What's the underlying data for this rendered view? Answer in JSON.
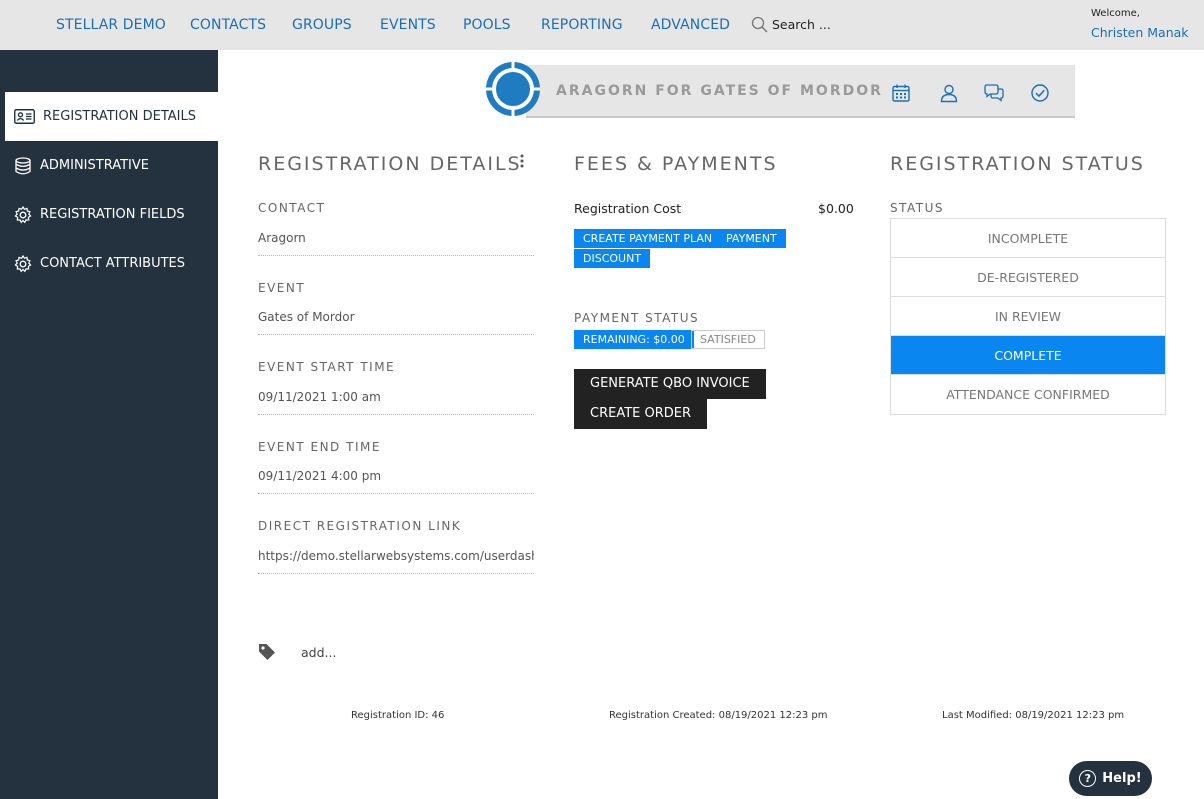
{
  "topnav": {
    "items": [
      "STELLAR DEMO",
      "CONTACTS",
      "GROUPS",
      "EVENTS",
      "POOLS",
      "REPORTING",
      "ADVANCED"
    ],
    "search_placeholder": "Search ...",
    "welcome": "Welcome,",
    "username": "Christen Manak"
  },
  "sidebar": {
    "items": [
      {
        "label": "REGISTRATION DETAILS",
        "icon": "contact-card-icon"
      },
      {
        "label": "ADMINISTRATIVE",
        "icon": "database-icon"
      },
      {
        "label": "REGISTRATION FIELDS",
        "icon": "gear-icon"
      },
      {
        "label": "CONTACT ATTRIBUTES",
        "icon": "gear-icon"
      }
    ]
  },
  "banner": {
    "title": "ARAGORN FOR GATES OF MORDOR",
    "icons": [
      "calendar-icon",
      "user-icon",
      "chat-icon",
      "check-circle-icon"
    ]
  },
  "details": {
    "title": "REGISTRATION DETAILS",
    "fields": [
      {
        "label": "CONTACT",
        "value": "Aragorn"
      },
      {
        "label": "EVENT",
        "value": "Gates of Mordor"
      },
      {
        "label": "EVENT START TIME",
        "value": "09/11/2021 1:00 am"
      },
      {
        "label": "EVENT END TIME",
        "value": "09/11/2021 4:00 pm"
      },
      {
        "label": "DIRECT REGISTRATION LINK",
        "value": "https://demo.stellarwebsystems.com/userdashboard"
      }
    ]
  },
  "fees": {
    "title": "FEES & PAYMENTS",
    "cost_label": "Registration Cost",
    "cost_value": "$0.00",
    "buttons": [
      "CREATE PAYMENT PLAN",
      "PAYMENT",
      "DISCOUNT"
    ],
    "payment_status_label": "PAYMENT STATUS",
    "remaining_badge": "REMAINING: $0.00",
    "satisfied_badge": "SATISFIED",
    "qbo_button": "GENERATE QBO INVOICE",
    "order_button": "CREATE ORDER"
  },
  "status": {
    "title": "REGISTRATION STATUS",
    "label": "STATUS",
    "options": [
      "INCOMPLETE",
      "DE-REGISTERED",
      "IN REVIEW",
      "COMPLETE",
      "ATTENDANCE CONFIRMED"
    ],
    "selected": "COMPLETE"
  },
  "tags": {
    "placeholder": "add..."
  },
  "footer": {
    "registration_id": "Registration ID: 46",
    "created": "Registration Created: 08/19/2021 12:23 pm",
    "modified": "Last Modified: 08/19/2021 12:23 pm"
  },
  "help": {
    "label": "Help!"
  },
  "colors": {
    "accent": "#0a86f0",
    "sidebar": "#24323f",
    "link": "#1a6fb5"
  }
}
